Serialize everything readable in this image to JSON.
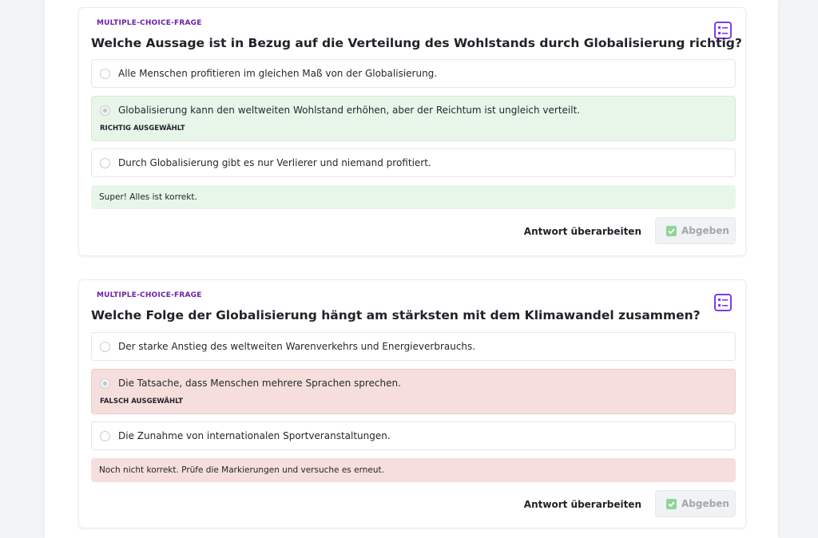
{
  "questions": [
    {
      "type_label": "MULTIPLE-CHOICE-FRAGE",
      "title": "Welche Aussage ist in Bezug auf die Verteilung des Wohlstands durch Globalisierung richtig?",
      "options": [
        {
          "text": "Alle Menschen profitieren im gleichen Maß von der Globalisierung."
        },
        {
          "text": "Globalisierung kann den weltweiten Wohlstand erhöhen, aber der Reichtum ist ungleich verteilt.",
          "status": "RICHTIG AUSGEWÄHLT"
        },
        {
          "text": "Durch Globalisierung gibt es nur Verlierer und niemand profitiert."
        }
      ],
      "feedback": "Super! Alles ist korrekt.",
      "revise_label": "Antwort überarbeiten",
      "submit_label": "Abgeben"
    },
    {
      "type_label": "MULTIPLE-CHOICE-FRAGE",
      "title": "Welche Folge der Globalisierung hängt am stärksten mit dem Klimawandel zusammen?",
      "options": [
        {
          "text": "Der starke Anstieg des weltweiten Warenverkehrs und Energieverbrauchs."
        },
        {
          "text": "Die Tatsache, dass Menschen mehrere Sprachen sprechen.",
          "status": "FALSCH AUSGEWÄHLT"
        },
        {
          "text": "Die Zunahme von internationalen Sportveranstaltungen."
        }
      ],
      "feedback": "Noch nicht korrekt. Prüfe die Markierungen und versuche es erneut.",
      "revise_label": "Antwort überarbeiten",
      "submit_label": "Abgeben"
    }
  ],
  "colors": {
    "accent": "#7c3aed",
    "type_label": "#6b21a8",
    "correct_bg": "#e8f5e9",
    "wrong_bg": "#f6dedd"
  },
  "icons": {
    "question_type": "list-icon",
    "submit": "checkbox-check-icon",
    "option": "radio-icon"
  }
}
